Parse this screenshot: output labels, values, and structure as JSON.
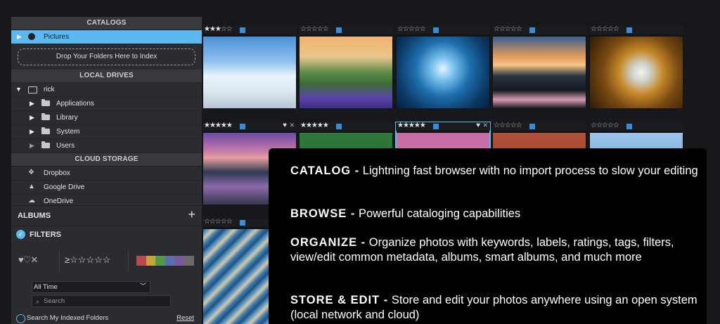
{
  "sidebar": {
    "catalogs_header": "CATALOGS",
    "catalog_item": "Pictures",
    "drop_zone": "Drop Your Folders Here to Index",
    "local_drives_header": "LOCAL DRIVES",
    "drive_root": "rick",
    "folders": [
      "Applications",
      "Library",
      "System",
      "Users"
    ],
    "cloud_header": "CLOUD STORAGE",
    "cloud_items": [
      "Dropbox",
      "Google Drive",
      "OneDrive"
    ],
    "albums_label": "ALBUMS",
    "albums_add": "+",
    "filters_label": "FILTERS",
    "hearts": "♥♡✕",
    "rating_filter": "≥☆☆☆☆☆",
    "label_colors": [
      "#b84a4f",
      "#c9a23a",
      "#4f9a4a",
      "#5a6fb0",
      "#7a5a9a",
      "#6a6a6a"
    ],
    "time_select": "All Time",
    "search_placeholder": "Search",
    "search_my_folders": "Search My Indexed Folders",
    "reset": "Reset"
  },
  "grid": {
    "row1_ratings": [
      3,
      0,
      0,
      0,
      0
    ],
    "row2_ratings": [
      5,
      5,
      5,
      0,
      0
    ],
    "row3_ratings": [
      0
    ],
    "selected_label": "selected thumbnail"
  },
  "overlay": {
    "items": [
      {
        "heading": "CATALOG -",
        "text": "Lightning fast browser with no import process to slow your editing"
      },
      {
        "heading": "BROWSE -",
        "text": "Powerful cataloging capabilities"
      },
      {
        "heading": "ORGANIZE -",
        "text": "Organize photos with keywords, labels, ratings, tags, filters, view/edit common metadata, albums, smart albums, and much more"
      },
      {
        "heading": "STORE & EDIT -",
        "text": "Store and edit your photos anywhere using an open system (local network and cloud)"
      }
    ]
  },
  "colors": {
    "accent": "#5bb8f0",
    "tag_blue": "#3a8bd8",
    "overlay_bg": "#000000",
    "sidebar_bg": "#2b2c30"
  }
}
